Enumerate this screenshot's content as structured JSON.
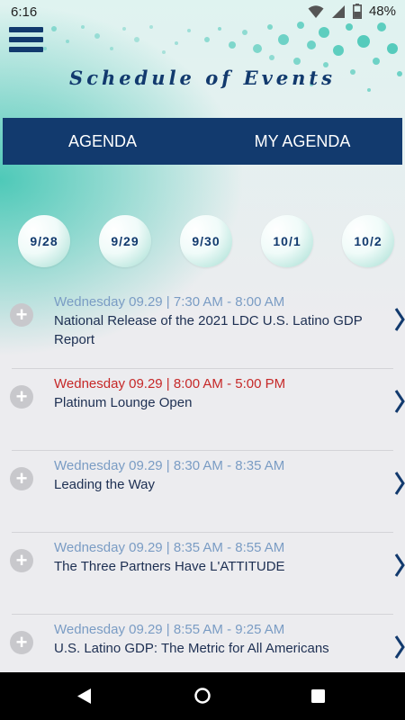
{
  "status": {
    "time": "6:16",
    "battery": "48%"
  },
  "header": {
    "title": "Schedule of Events"
  },
  "tabs": [
    {
      "label": "AGENDA"
    },
    {
      "label": "MY AGENDA"
    }
  ],
  "dates": [
    "9/28",
    "9/29",
    "9/30",
    "10/1",
    "10/2"
  ],
  "events": [
    {
      "time": "Wednesday 09.29 | 7:30 AM - 8:00 AM",
      "name": "National Release of the 2021 LDC U.S. Latino GDP Report",
      "active": false
    },
    {
      "time": "Wednesday 09.29 | 8:00 AM - 5:00 PM",
      "name": "Platinum Lounge Open",
      "active": true
    },
    {
      "time": "Wednesday 09.29 | 8:30 AM - 8:35 AM",
      "name": "Leading the Way",
      "active": false
    },
    {
      "time": "Wednesday 09.29 | 8:35 AM - 8:55 AM",
      "name": "The Three Partners Have L'ATTITUDE",
      "active": false
    },
    {
      "time": "Wednesday 09.29 | 8:55 AM - 9:25 AM",
      "name": "U.S. Latino GDP: The Metric for All Americans",
      "active": false
    }
  ],
  "colors": {
    "navy": "#123a6e",
    "teal": "#4ec9b8",
    "active_time": "#c62828",
    "time": "#7a9cc4"
  }
}
